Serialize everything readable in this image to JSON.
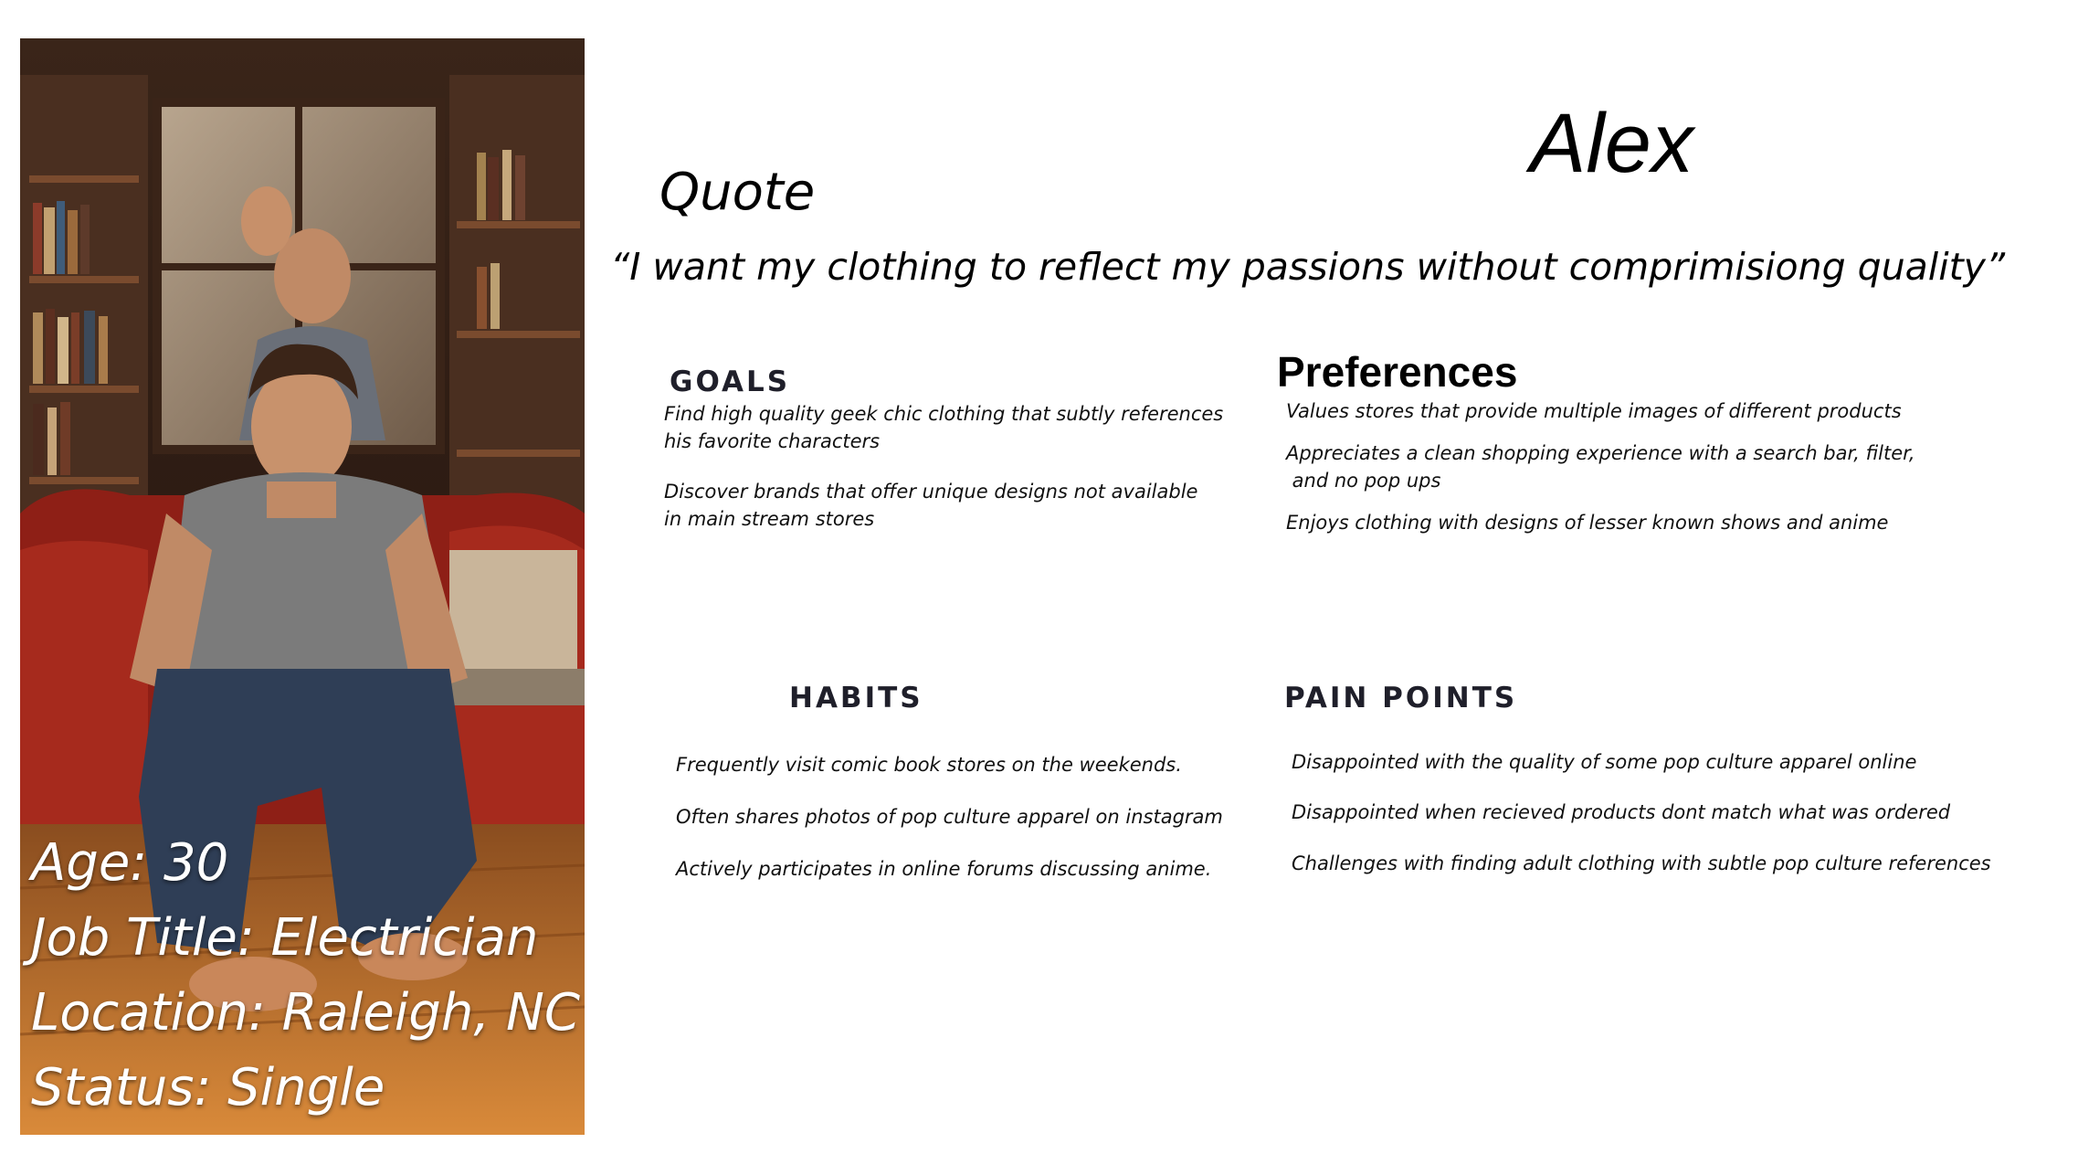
{
  "persona": {
    "name": "Alex",
    "quote_heading": "Quote",
    "quote": "“I want my clothing to reflect my passions without comprimisiong quality”"
  },
  "profile": {
    "age": "Age: 30",
    "job_title": "Job Title: Electrician",
    "location": "Location: Raleigh, NC",
    "status": "Status: Single"
  },
  "goals": {
    "heading": "GOALS",
    "items": [
      "Find high quality geek chic clothing that subtly references",
      "his favorite characters",
      "Discover brands that offer unique designs not available",
      "in main stream  stores"
    ]
  },
  "preferences": {
    "heading": "Preferences",
    "items": [
      "Values stores that provide multiple images of different products",
      "Appreciates a clean shopping experience with a search bar, filter,",
      " and no pop ups",
      "Enjoys clothing with designs of lesser known shows and anime"
    ]
  },
  "habits": {
    "heading": "HABITS",
    "items": [
      "Frequently visit comic book stores on the weekends.",
      "Often shares photos of pop culture apparel on instagram",
      "Actively participates in online forums discussing anime."
    ]
  },
  "pain_points": {
    "heading": "PAIN POINTS",
    "items": [
      "Disappointed with the quality of some pop culture apparel online",
      "Disappointed when recieved products dont match what was ordered",
      "Challenges with finding adult clothing with subtle pop culture references"
    ]
  },
  "image": {
    "subject": "man-sitting-on-red-couch-photo"
  }
}
